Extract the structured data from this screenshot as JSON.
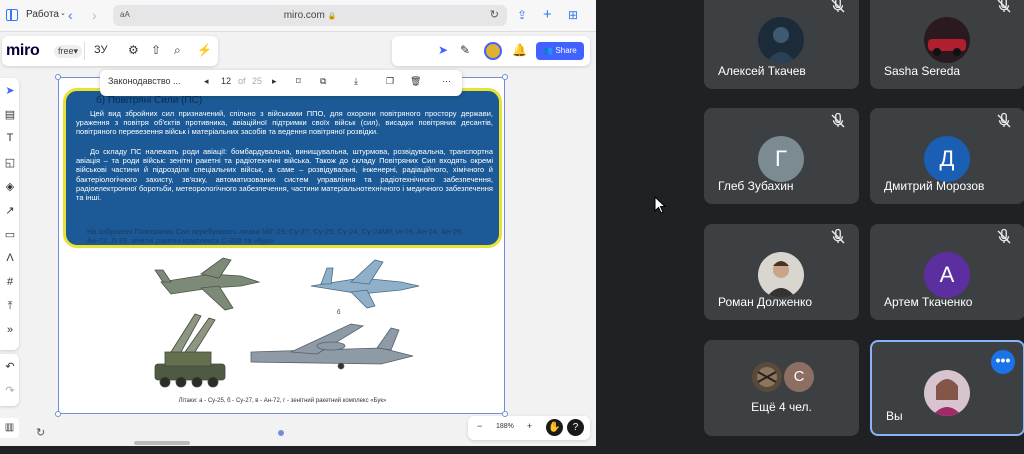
{
  "safari": {
    "tab_title": "Работа",
    "aa_label": "аА",
    "url": "miro.com"
  },
  "miro": {
    "logo": "miro",
    "plan_badge": "free",
    "board_name": "ЗУ",
    "share_label": "Share"
  },
  "doc_toolbar": {
    "title": "Законодавство ...",
    "page": "12",
    "of_label": "of",
    "total": "25"
  },
  "document": {
    "section_title": "б) Повітряні Сили (ПС)",
    "paragraph1": "Цей вид збройних сил призначений, спільно з військами ППО, для охорони повітряного простору держави, ураження з повітря об'єктів противника, авіаційної підтримки своїх військ (сил), висадки повітряних десантів, повітряного перевезення військ і матеріальних засобів та ведення повітряної розвідки.",
    "paragraph2": "До складу ПС належать роди авіації: бомбардувальна, винищувальна, штурмова, розвідувальна, транспортна авіація – та роди військ: зенітні ракетні та радіотехнічні війська. Також до складу Повітряних Сил входять окремі військові частини й підрозділи спеціальних військ, а саме – розвідувальні, інженерні, радіаційного, хімічного й бактеріологічного захисту, зв'язку, автоматизованих систем управління та радіотехнічного забезпечення, радіоелектронної боротьби, метеорологічного забезпечення, частини матеріальнотехнічного і медичного забезпечення та інші.",
    "paragraph3": "На озброєнні Повітряних Сил перебувають літаки МіГ-29, Су-27, Су-25, Су-24, Су-24МР, Іл-76, Ан-24, Ан-26, Ан-72, Л-39, зенітні ракетні комплекси С-300 та «Бук»",
    "fig_letter_b": "б",
    "caption": "Літаки: а - Су-25, б - Су-27, в - Ан-72, г - зенітний ракетний комплекс «Бук»"
  },
  "zoom": {
    "minus": "−",
    "level": "188%",
    "plus": "+",
    "help": "?"
  },
  "participants": [
    {
      "name": "Алексей Ткачев",
      "type": "photo",
      "muted": true
    },
    {
      "name": "Sasha Sereda",
      "type": "photo",
      "muted": true
    },
    {
      "name": "Глеб Зубахин",
      "type": "letter",
      "letter": "Г",
      "color": "#7c8b92",
      "muted": true
    },
    {
      "name": "Дмитрий Морозов",
      "type": "letter",
      "letter": "Д",
      "color": "#1a5fb4",
      "muted": true
    },
    {
      "name": "Роман Долженко",
      "type": "photo",
      "muted": true
    },
    {
      "name": "Артем Ткаченко",
      "type": "letter",
      "letter": "А",
      "color": "#5b2fa0",
      "muted": true
    },
    {
      "name": "Ещё 4 чел.",
      "type": "group",
      "letter": "С",
      "color": "#8d6e63"
    },
    {
      "name": "Вы",
      "type": "self",
      "more": "•••"
    }
  ],
  "colors": {
    "meet_bg": "#202124",
    "tile_bg": "#3c4043",
    "self_border": "#8ab4f8",
    "miro_accent": "#4262ff",
    "doc_blue": "#1b5a96",
    "doc_yellow": "#e8e235"
  }
}
